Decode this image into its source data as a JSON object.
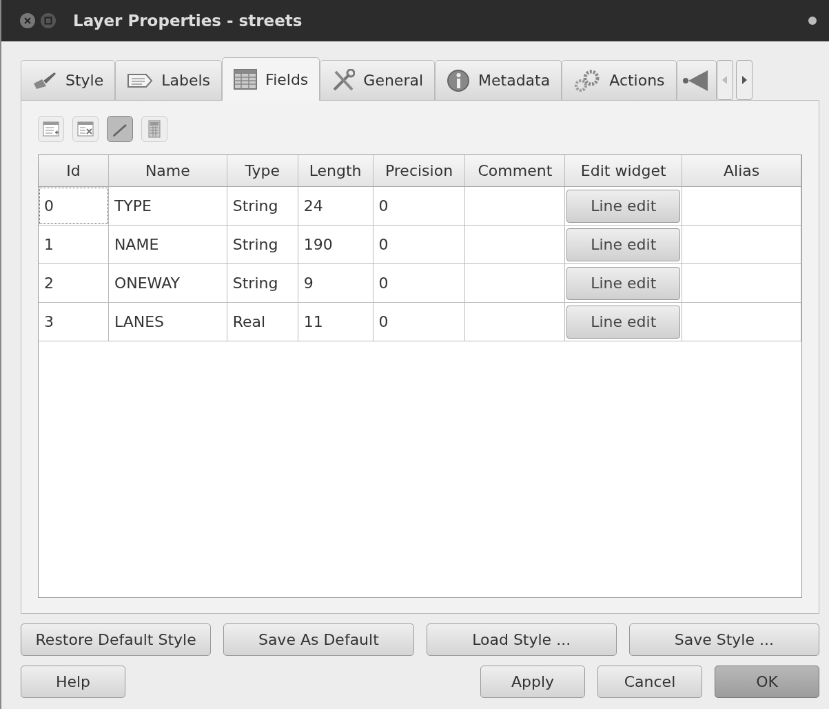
{
  "window": {
    "title": "Layer Properties - streets"
  },
  "tabs": [
    {
      "label": "Style",
      "kind": "brush",
      "selected": false
    },
    {
      "label": "Labels",
      "kind": "tag",
      "selected": false
    },
    {
      "label": "Fields",
      "kind": "table",
      "selected": true
    },
    {
      "label": "General",
      "kind": "tools",
      "selected": false
    },
    {
      "label": "Metadata",
      "kind": "info",
      "selected": false
    },
    {
      "label": "Actions",
      "kind": "gears",
      "selected": false
    }
  ],
  "toolbar": [
    {
      "kind": "add",
      "pressed": false
    },
    {
      "kind": "delete",
      "pressed": false
    },
    {
      "kind": "pencil",
      "pressed": true
    },
    {
      "kind": "calculator",
      "pressed": false
    }
  ],
  "table": {
    "columns": [
      "Id",
      "Name",
      "Type",
      "Length",
      "Precision",
      "Comment",
      "Edit widget",
      "Alias"
    ],
    "rows": [
      {
        "focused": true,
        "cells": [
          "0",
          "TYPE",
          "String",
          "24",
          "0"
        ],
        "widget": "Line edit"
      },
      {
        "focused": false,
        "cells": [
          "1",
          "NAME",
          "String",
          "190",
          "0"
        ],
        "widget": "Line edit"
      },
      {
        "focused": false,
        "cells": [
          "2",
          "ONEWAY",
          "String",
          "9",
          "0"
        ],
        "widget": "Line edit"
      },
      {
        "focused": false,
        "cells": [
          "3",
          "LANES",
          "Real",
          "11",
          "0"
        ],
        "widget": "Line edit"
      }
    ]
  },
  "style_buttons": [
    "Restore Default Style",
    "Save As Default",
    "Load Style ...",
    "Save Style ..."
  ],
  "dialog_buttons": [
    {
      "label": "Help",
      "default": false
    },
    {
      "label": "Apply",
      "default": false
    },
    {
      "label": "Cancel",
      "default": false
    },
    {
      "label": "OK",
      "default": true
    }
  ]
}
